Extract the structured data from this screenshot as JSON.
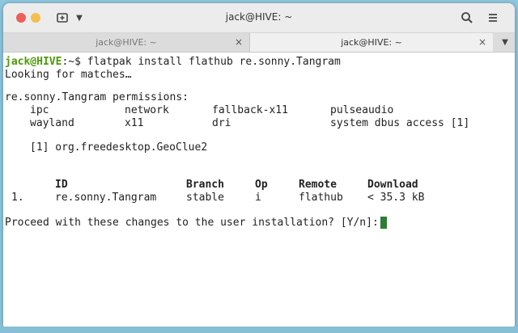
{
  "window": {
    "title": "jack@HIVE: ~"
  },
  "tabs": [
    {
      "label": "jack@HIVE: ~",
      "close": "×"
    },
    {
      "label": "jack@HIVE: ~",
      "close": "×"
    }
  ],
  "terminal": {
    "prompt_user": "jack@HIVE",
    "prompt_sep": ":~$",
    "command": " flatpak install flathub re.sonny.Tangram",
    "looking": "Looking for matches…",
    "permissions_heading": "re.sonny.Tangram permissions:",
    "permissions": [
      [
        "ipc",
        "network",
        "fallback-x11",
        "pulseaudio"
      ],
      [
        "wayland",
        "x11",
        "dri",
        "system dbus access [1]"
      ]
    ],
    "footnote": "[1] org.freedesktop.GeoClue2",
    "table": {
      "headers": [
        "ID",
        "Branch",
        "Op",
        "Remote",
        "Download"
      ],
      "rows": [
        {
          "num": "1.",
          "cells": [
            "re.sonny.Tangram",
            "stable",
            "i",
            "flathub",
            "< 35.3 kB"
          ]
        }
      ]
    },
    "proceed": "Proceed with these changes to the user installation? [Y/n]:"
  },
  "colors": {
    "prompt_user": "#4e9a06",
    "prompt_path": "#3465a4",
    "cursor": "#2e7d32"
  }
}
